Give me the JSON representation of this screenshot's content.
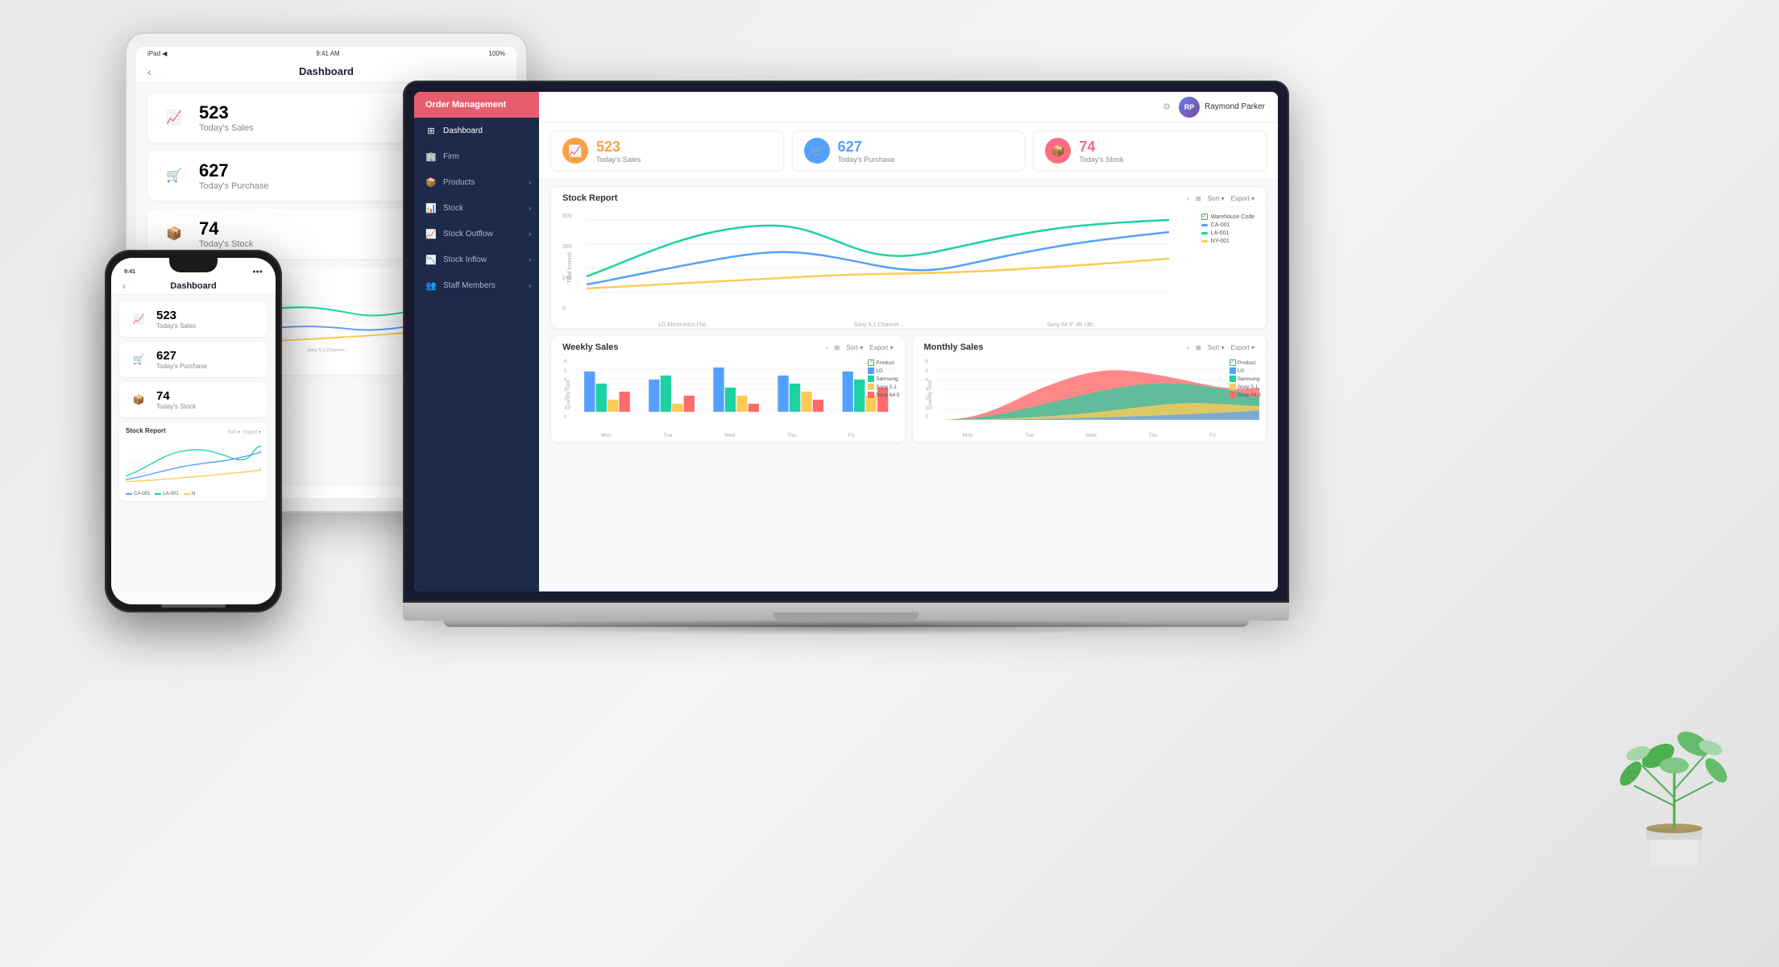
{
  "app": {
    "name": "Order Management",
    "accent_color": "#e85d6e"
  },
  "sidebar": {
    "items": [
      {
        "label": "Dashboard",
        "icon": "⊞",
        "active": true
      },
      {
        "label": "Firm",
        "icon": "🏢"
      },
      {
        "label": "Products",
        "icon": "📦",
        "has_arrow": true
      },
      {
        "label": "Stock",
        "icon": "📊",
        "has_arrow": true
      },
      {
        "label": "Stock Outflow",
        "icon": "📈",
        "has_arrow": true
      },
      {
        "label": "Stock Inflow",
        "icon": "📉",
        "has_arrow": true
      },
      {
        "label": "Staff Members",
        "icon": "👥",
        "has_arrow": true
      }
    ]
  },
  "user": {
    "name": "Raymond Parker"
  },
  "stats": {
    "sales": {
      "value": "523",
      "label": "Today's Sales",
      "color": "orange"
    },
    "purchase": {
      "value": "627",
      "label": "Today's Purchase",
      "color": "blue"
    },
    "stock": {
      "value": "74",
      "label": "Today's Stock",
      "color": "pink"
    }
  },
  "stock_report": {
    "title": "Stock Report",
    "y_labels": [
      "600",
      "360",
      "240",
      "0"
    ],
    "y_axis_label": "Total Instock",
    "x_labels": [
      "LG Electronics Flat...",
      "Sony 5.1 Channel...",
      "Sony 64.5\" 4K Ultr..."
    ],
    "legend": [
      {
        "label": "Warehouse Code",
        "color": "#ccc"
      },
      {
        "label": "CA-001",
        "color": "#54a0ff"
      },
      {
        "label": "LA-001",
        "color": "#1dd1a1"
      },
      {
        "label": "NY-001",
        "color": "#feca57"
      }
    ]
  },
  "weekly_sales": {
    "title": "Weekly Sales",
    "y_label": "Quantity Sold",
    "x_labels": [
      "Mon",
      "Tue",
      "Wed",
      "Thu",
      "Fri"
    ],
    "legend": [
      {
        "label": "LG",
        "color": "#54a0ff"
      },
      {
        "label": "Samsung",
        "color": "#1dd1a1"
      },
      {
        "label": "Sony 5.1",
        "color": "#feca57"
      },
      {
        "label": "Sony 64.5",
        "color": "#ff6b6b"
      }
    ],
    "product_check": "Product"
  },
  "monthly_sales": {
    "title": "Monthly Sales",
    "y_label": "Quantity Sold",
    "x_labels": [
      "Mon",
      "Tue",
      "Wed",
      "Thu",
      "Fri"
    ],
    "legend": [
      {
        "label": "LG",
        "color": "#54a0ff"
      },
      {
        "label": "Samsung",
        "color": "#1dd1a1"
      },
      {
        "label": "Sony 5.1",
        "color": "#feca57"
      },
      {
        "label": "Sony 64.5",
        "color": "#ff6b6b"
      }
    ],
    "product_check": "Product"
  },
  "tablet": {
    "title": "Dashboard",
    "status_time": "9:41 AM",
    "battery": "100%",
    "model": "iPad ◀"
  },
  "phone": {
    "title": "Dashboard",
    "status_time": "9:41",
    "signal": "●●●"
  }
}
